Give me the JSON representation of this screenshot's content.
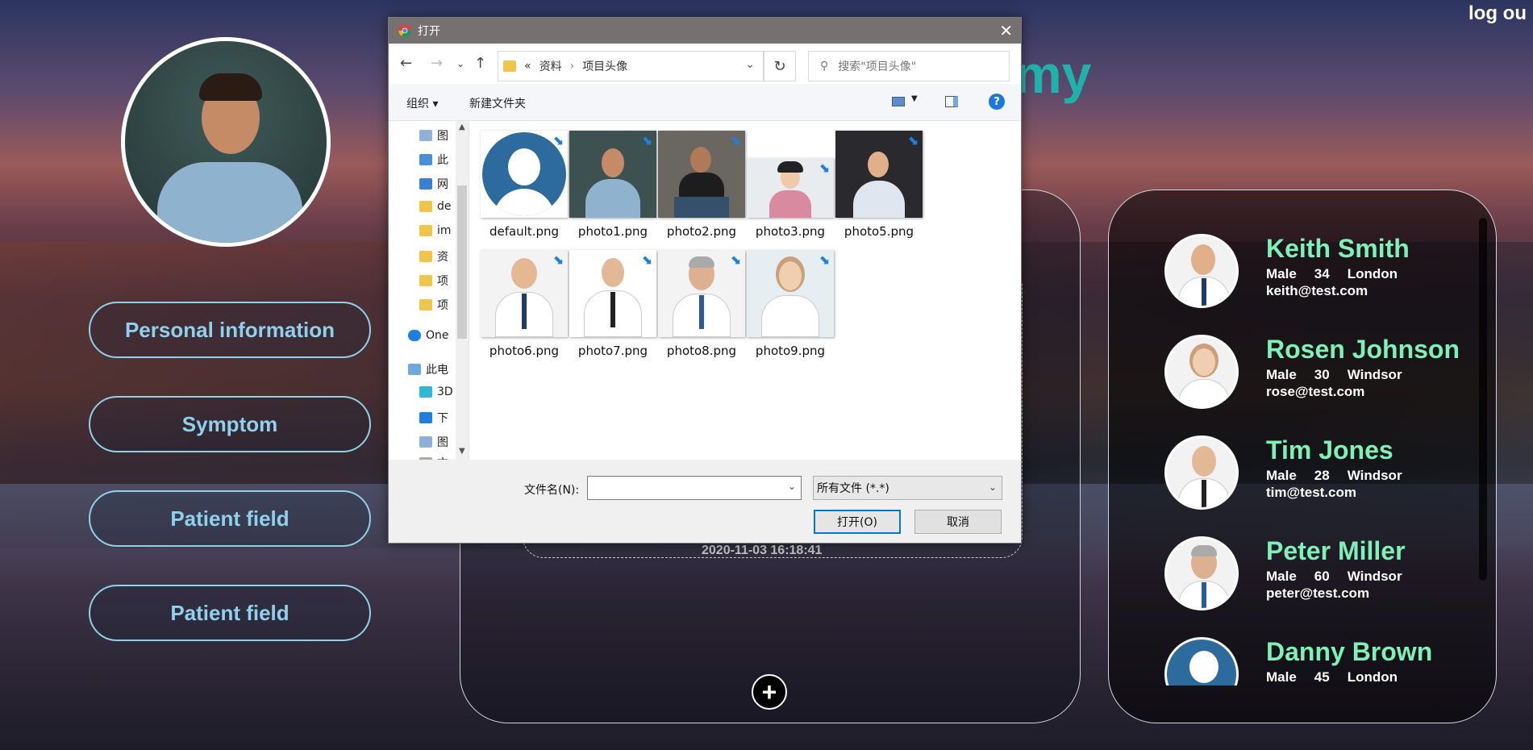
{
  "header": {
    "logout_label": "log ou",
    "title_fragment": "my"
  },
  "sidebar": {
    "items": [
      {
        "label": "Personal information"
      },
      {
        "label": "Symptom"
      },
      {
        "label": "Patient field"
      },
      {
        "label": "Patient field"
      }
    ]
  },
  "center": {
    "date": "2020-11-03 16:18:41",
    "add_label": "+"
  },
  "doctors": [
    {
      "name": "Keith Smith",
      "gender": "Male",
      "age": "34",
      "city": "London",
      "email": "keith@test.com"
    },
    {
      "name": "Rosen Johnson",
      "gender": "Male",
      "age": "30",
      "city": "Windsor",
      "email": "rose@test.com"
    },
    {
      "name": "Tim Jones",
      "gender": "Male",
      "age": "28",
      "city": "Windsor",
      "email": "tim@test.com"
    },
    {
      "name": "Peter Miller",
      "gender": "Male",
      "age": "60",
      "city": "Windsor",
      "email": "peter@test.com"
    },
    {
      "name": "Danny Brown",
      "gender": "Male",
      "age": "45",
      "city": "London",
      "email": ""
    }
  ],
  "dialog": {
    "title": "打开",
    "breadcrumb": [
      "«",
      "资料",
      "›",
      "项目头像"
    ],
    "search_placeholder": "搜索\"项目头像\"",
    "toolbar": {
      "organize": "组织 ▾",
      "new_folder": "新建文件夹"
    },
    "tree": [
      "图",
      "此",
      "网",
      "de",
      "im",
      "资",
      "项",
      "项",
      "One",
      "此电",
      "3D",
      "下",
      "图",
      "文"
    ],
    "files": [
      "default.png",
      "photo1.png",
      "photo2.png",
      "photo3.png",
      "photo5.png",
      "photo6.png",
      "photo7.png",
      "photo8.png",
      "photo9.png"
    ],
    "filename_label": "文件名(N):",
    "filename_value": "",
    "filetype": "所有文件 (*.*)",
    "open_label": "打开(O)",
    "cancel_label": "取消"
  }
}
